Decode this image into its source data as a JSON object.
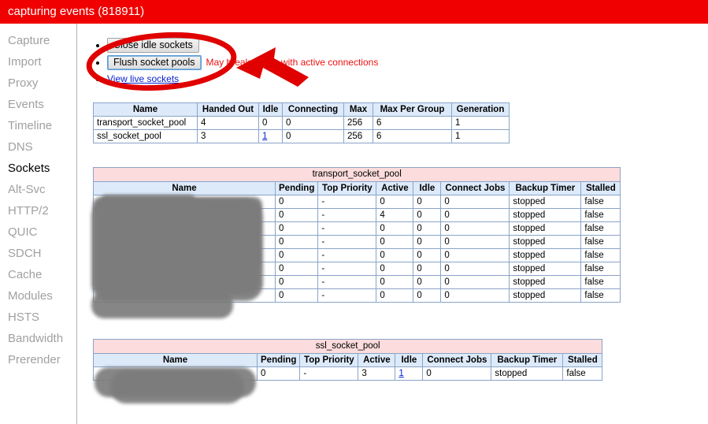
{
  "banner": {
    "text": "capturing events (818911)",
    "color": "#f00000"
  },
  "sidebar": {
    "items": [
      {
        "label": "Capture",
        "selected": false
      },
      {
        "label": "Import",
        "selected": false
      },
      {
        "label": "Proxy",
        "selected": false
      },
      {
        "label": "Events",
        "selected": false
      },
      {
        "label": "Timeline",
        "selected": false
      },
      {
        "label": "DNS",
        "selected": false
      },
      {
        "label": "Sockets",
        "selected": true
      },
      {
        "label": "Alt-Svc",
        "selected": false
      },
      {
        "label": "HTTP/2",
        "selected": false
      },
      {
        "label": "QUIC",
        "selected": false
      },
      {
        "label": "SDCH",
        "selected": false
      },
      {
        "label": "Cache",
        "selected": false
      },
      {
        "label": "Modules",
        "selected": false
      },
      {
        "label": "HSTS",
        "selected": false
      },
      {
        "label": "Bandwidth",
        "selected": false
      },
      {
        "label": "Prerender",
        "selected": false
      }
    ]
  },
  "actions": {
    "close_idle_label": "Close idle sockets",
    "flush_pools_label": "Flush socket pools",
    "flush_pools_hint": "May break pages with active connections",
    "view_live_label": "View live sockets"
  },
  "pools_summary": {
    "columns": [
      "Name",
      "Handed Out",
      "Idle",
      "Connecting",
      "Max",
      "Max Per Group",
      "Generation"
    ],
    "rows": [
      {
        "name": "transport_socket_pool",
        "handed_out": "4",
        "idle": "0",
        "idle_link": false,
        "connecting": "0",
        "max": "256",
        "max_per_group": "6",
        "generation": "1"
      },
      {
        "name": "ssl_socket_pool",
        "handed_out": "3",
        "idle": "1",
        "idle_link": true,
        "connecting": "0",
        "max": "256",
        "max_per_group": "6",
        "generation": "1"
      }
    ]
  },
  "transport_pool": {
    "title": "transport_socket_pool",
    "columns": [
      "Name",
      "Pending",
      "Top Priority",
      "Active",
      "Idle",
      "Connect Jobs",
      "Backup Timer",
      "Stalled"
    ],
    "rows": [
      {
        "name": "",
        "redacted": true,
        "pending": "0",
        "top_priority": "-",
        "active": "0",
        "idle": "0",
        "idle_link": false,
        "connect_jobs": "0",
        "backup_timer": "stopped",
        "stalled": "false"
      },
      {
        "name": "",
        "redacted": true,
        "pending": "0",
        "top_priority": "-",
        "active": "4",
        "idle": "0",
        "idle_link": false,
        "connect_jobs": "0",
        "backup_timer": "stopped",
        "stalled": "false"
      },
      {
        "name": "",
        "redacted": true,
        "pending": "0",
        "top_priority": "-",
        "active": "0",
        "idle": "0",
        "idle_link": false,
        "connect_jobs": "0",
        "backup_timer": "stopped",
        "stalled": "false"
      },
      {
        "name": "",
        "redacted": true,
        "pending": "0",
        "top_priority": "-",
        "active": "0",
        "idle": "0",
        "idle_link": false,
        "connect_jobs": "0",
        "backup_timer": "stopped",
        "stalled": "false"
      },
      {
        "name": "",
        "redacted": true,
        "pending": "0",
        "top_priority": "-",
        "active": "0",
        "idle": "0",
        "idle_link": false,
        "connect_jobs": "0",
        "backup_timer": "stopped",
        "stalled": "false"
      },
      {
        "name": "",
        "redacted": true,
        "pending": "0",
        "top_priority": "-",
        "active": "0",
        "idle": "0",
        "idle_link": false,
        "connect_jobs": "0",
        "backup_timer": "stopped",
        "stalled": "false"
      },
      {
        "name": "",
        "redacted": true,
        "pending": "0",
        "top_priority": "-",
        "active": "0",
        "idle": "0",
        "idle_link": false,
        "connect_jobs": "0",
        "backup_timer": "stopped",
        "stalled": "false"
      },
      {
        "name": "",
        "redacted": true,
        "pending": "0",
        "top_priority": "-",
        "active": "0",
        "idle": "0",
        "idle_link": false,
        "connect_jobs": "0",
        "backup_timer": "stopped",
        "stalled": "false"
      }
    ]
  },
  "ssl_pool": {
    "title": "ssl_socket_pool",
    "columns": [
      "Name",
      "Pending",
      "Top Priority",
      "Active",
      "Idle",
      "Connect Jobs",
      "Backup Timer",
      "Stalled"
    ],
    "rows": [
      {
        "name": "",
        "redacted": true,
        "pending": "0",
        "top_priority": "-",
        "active": "3",
        "idle": "1",
        "idle_link": true,
        "connect_jobs": "0",
        "backup_timer": "stopped",
        "stalled": "false"
      }
    ]
  },
  "annotation": {
    "color": "#e00000",
    "shapes": [
      "ellipse-around-buttons",
      "arrow-pointing-left"
    ]
  },
  "colors": {
    "banner_red": "#f00000",
    "table_header_blue": "#ddeafa",
    "pool_title_pink": "#fcdcdc",
    "table_border": "#8aa4c8",
    "link_blue": "#0a24d1",
    "hint_red": "#ee1111",
    "redaction_grey": "#7c7c7c"
  }
}
